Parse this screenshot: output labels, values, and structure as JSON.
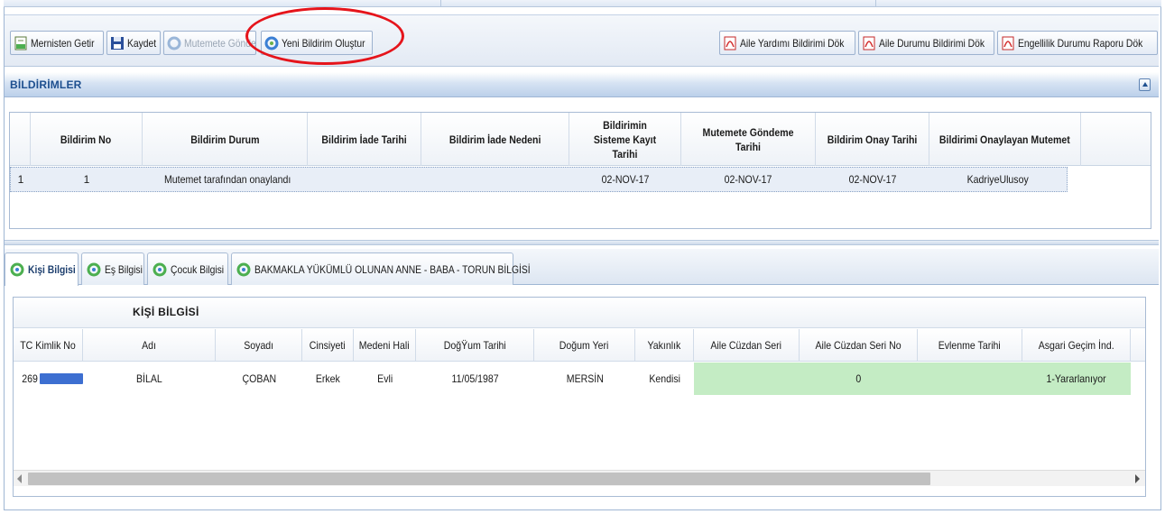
{
  "colors": {
    "accent": "#1d4f8f",
    "highlight_row": "#e8eef7",
    "green_cell": "#c4ecc4",
    "annotation_circle": "#e5141b"
  },
  "toolbar": {
    "mernis_label": "Mernisten Getir",
    "kaydet_label": "Kaydet",
    "mutemete_label": "Mutemete Gönder",
    "yeni_label": "Yeni Bildirim Oluştur",
    "aile_yardim_label": "Aile Yardımı Bildirimi Dök",
    "aile_durum_label": "Aile Durumu Bildirimi Dök",
    "engellilik_label": "Engellilik Durumu Raporu Dök"
  },
  "bildirimler": {
    "title": "BİLDİRİMLER",
    "columns": [
      "Bildirim No",
      "Bildirim Durum",
      "Bildirim İade Tarihi",
      "Bildirim İade Nedeni",
      "Bildirimin Sisteme Kayıt Tarihi",
      "Mutemete Göndeme Tarihi",
      "Bildirim Onay Tarihi",
      "Bildirimi Onaylayan Mutemet"
    ],
    "row": {
      "index": "1",
      "no": "1",
      "durum": "Mutemet tarafından onaylandı",
      "iade_tarihi": "",
      "iade_nedeni": "",
      "kayit_tarihi": "02-NOV-17",
      "mutemet_tarihi": "02-NOV-17",
      "onay_tarihi": "02-NOV-17",
      "onaylayan": "KadriyeUlusoy"
    }
  },
  "tabs": [
    "Kişi Bilgisi",
    "Eş Bilgisi",
    "Çocuk Bilgisi",
    "BAKMAKLA YÜKÜMLÜ OLUNAN ANNE - BABA - TORUN BİLGİSİ"
  ],
  "kisi": {
    "group_title": "KİŞİ BİLGİSİ",
    "columns": [
      "TC Kimlik No",
      "Adı",
      "Soyadı",
      "Cinsiyeti",
      "Medeni Hali",
      "DoğŸum Tarihi",
      "Doğum Yeri",
      "Yakınlık",
      "Aile Cüzdan Seri",
      "Aile Cüzdan Seri No",
      "Evlenme Tarihi",
      "Asgari Geçim İnd."
    ],
    "row": {
      "tc_prefix": "269",
      "adi": "BİLAL",
      "soyadi": "ÇOBAN",
      "cinsiyet": "Erkek",
      "medeni": "Evli",
      "dogum_tarihi": "11/05/1987",
      "dogum_yeri": "MERSİN",
      "yakinlik": "Kendisi",
      "cuzdan_seri": "",
      "cuzdan_seri_no": "0",
      "evlenme_tarihi": "",
      "asgari": "1-Yararlanıyor"
    }
  }
}
